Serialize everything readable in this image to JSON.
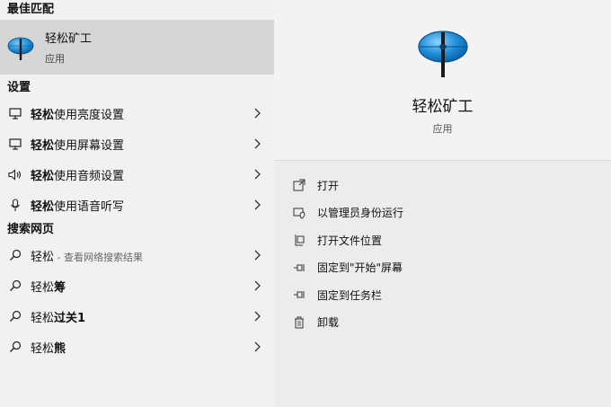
{
  "left": {
    "best_match_header": "最佳匹配",
    "best_match": {
      "title": "轻松矿工",
      "subtitle": "应用",
      "icon": "pickaxe-app-icon"
    },
    "settings_header": "设置",
    "settings": [
      {
        "bold": "轻松",
        "rest": "使用亮度设置",
        "icon": "monitor-icon"
      },
      {
        "bold": "轻松",
        "rest": "使用屏幕设置",
        "icon": "monitor-icon"
      },
      {
        "bold": "轻松",
        "rest": "使用音频设置",
        "icon": "speaker-icon"
      },
      {
        "bold": "轻松",
        "rest": "使用语音听写",
        "icon": "microphone-icon"
      }
    ],
    "web_header": "搜索网页",
    "web": [
      {
        "bold": "轻松",
        "hint": " - 查看网络搜索结果",
        "rest": "",
        "icon": "search-icon"
      },
      {
        "bold": "",
        "prefix": "轻松",
        "boldpart": "筹",
        "icon": "search-icon"
      },
      {
        "bold": "",
        "prefix": "轻松",
        "boldpart": "过关1",
        "icon": "search-icon"
      },
      {
        "bold": "",
        "prefix": "轻松",
        "boldpart": "熊",
        "icon": "search-icon"
      }
    ]
  },
  "right": {
    "app_title": "轻松矿工",
    "app_type": "应用",
    "actions": [
      {
        "label": "打开",
        "icon": "open-icon"
      },
      {
        "label": "以管理员身份运行",
        "icon": "admin-shield-icon"
      },
      {
        "label": "打开文件位置",
        "icon": "file-location-icon"
      },
      {
        "label": "固定到\"开始\"屏幕",
        "icon": "pin-icon"
      },
      {
        "label": "固定到任务栏",
        "icon": "pin-icon"
      },
      {
        "label": "卸载",
        "icon": "trash-icon"
      }
    ]
  },
  "colors": {
    "best_match_bg": "#d6d6d6",
    "left_bg": "#f1f1f1",
    "right_bg": "#ececec",
    "icon_blue": "#1e8ed8"
  }
}
